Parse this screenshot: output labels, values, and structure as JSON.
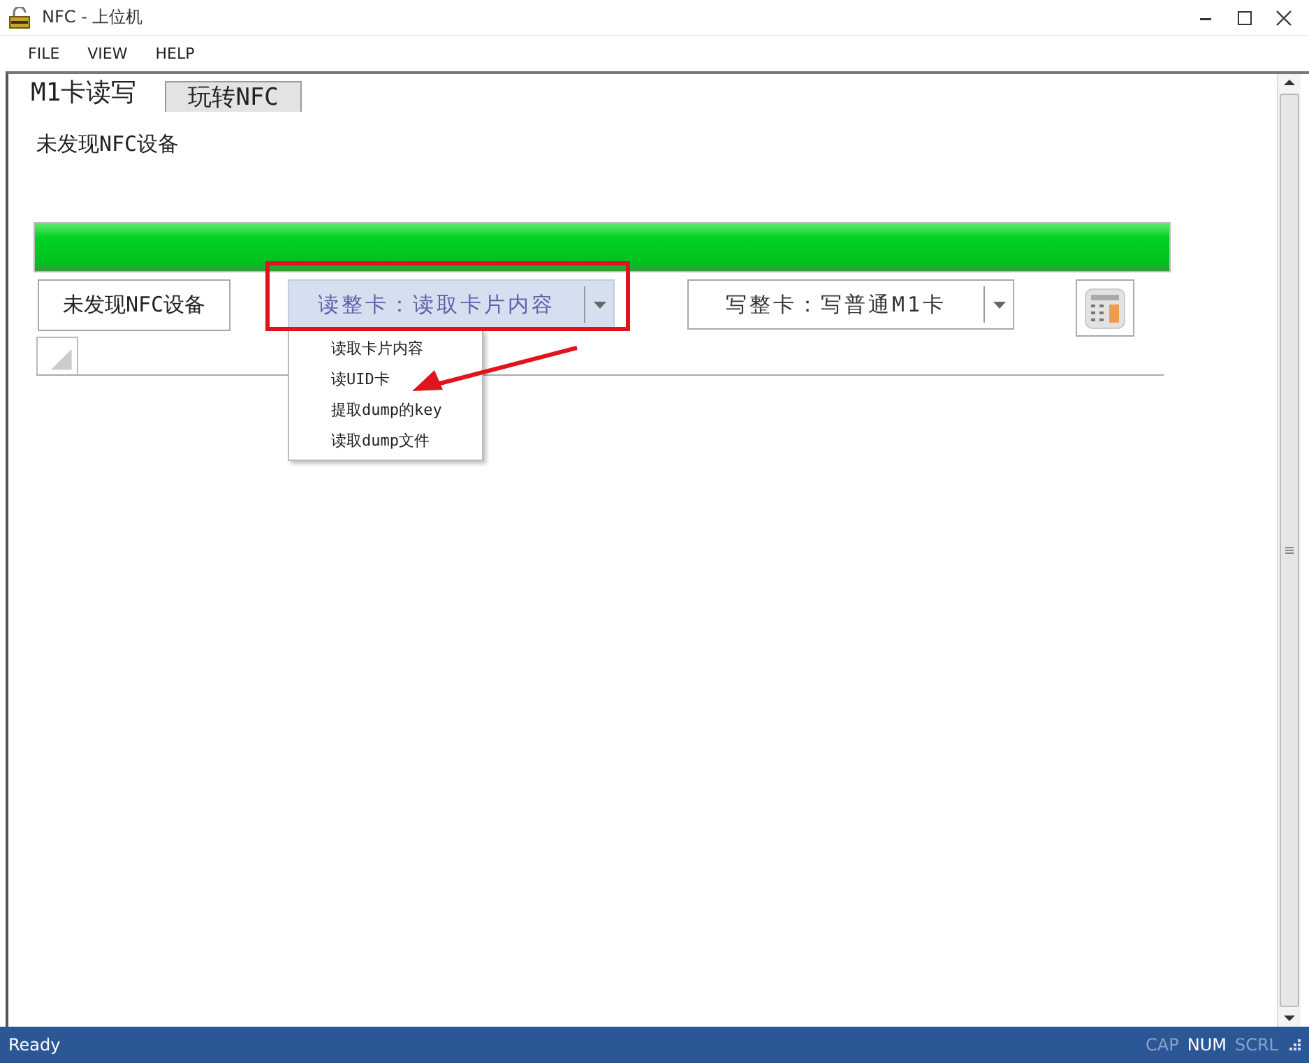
{
  "window": {
    "title": "NFC - 上位机"
  },
  "menu": [
    {
      "label": "FILE"
    },
    {
      "label": "VIEW"
    },
    {
      "label": "HELP"
    }
  ],
  "tabs": [
    {
      "label": "M1卡读写",
      "selected": true
    },
    {
      "label": "玩转NFC",
      "selected": false
    }
  ],
  "device_status": "未发现NFC设备",
  "progress": {
    "level": 1
  },
  "device_box": "未发现NFC设备",
  "read_combo": {
    "value": "读整卡：读取卡片内容",
    "focused": true,
    "expanded": true,
    "options": [
      {
        "label": "读取卡片内容"
      },
      {
        "label": "读UID卡"
      },
      {
        "label": "提取dump的key"
      },
      {
        "label": "读取dump文件"
      }
    ]
  },
  "write_combo": {
    "value": "写整卡：写普通M1卡",
    "focused": false,
    "expanded": false
  },
  "status_bar": {
    "text": "Ready",
    "indicators": [
      {
        "label": "CAP",
        "on": false
      },
      {
        "label": "NUM",
        "on": true
      },
      {
        "label": "SCRL",
        "on": false
      }
    ]
  }
}
